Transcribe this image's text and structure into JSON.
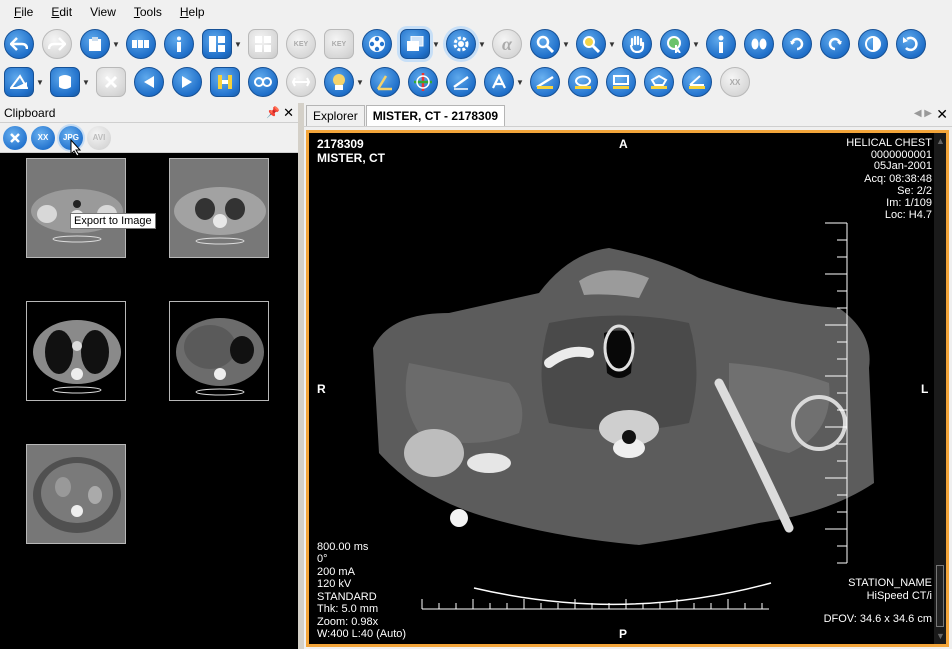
{
  "menu": {
    "file": {
      "accel": "F",
      "rest": "ile"
    },
    "edit": {
      "accel": "E",
      "rest": "dit"
    },
    "view": {
      "accel": "",
      "rest": "View"
    },
    "tools": {
      "accel": "T",
      "rest": "ools"
    },
    "help": {
      "accel": "H",
      "rest": "elp"
    }
  },
  "toolbar2": {
    "jpg_label": "JPG",
    "avi_label": "AVI"
  },
  "toolbar1": {
    "key_label_1": "KEY",
    "key_label_2": "KEY"
  },
  "clipboard": {
    "title": "Clipboard",
    "tool_xx": "XX",
    "tool_jpg": "JPG",
    "tool_avi": "AVI",
    "tooltip": "Export to Image",
    "thumb_count": 5
  },
  "tabs": [
    {
      "label": "Explorer"
    },
    {
      "label": "MISTER, CT - 2178309"
    }
  ],
  "viewer": {
    "top_left": {
      "id": "2178309",
      "name": "MISTER, CT"
    },
    "top_right": [
      "HELICAL CHEST",
      "0000000001",
      "05Jan-2001",
      "Acq: 08:38:48",
      "Se: 2/2",
      "Im: 1/109",
      "Loc: H4.7"
    ],
    "orient": {
      "top": "A",
      "bottom": "P",
      "left": "R",
      "right": "L"
    },
    "bottom_left": [
      "800.00 ms",
      "0°",
      "200 mA",
      "120 kV",
      "STANDARD",
      "Thk: 5.0 mm",
      "Zoom: 0.98x",
      "W:400 L:40 (Auto)"
    ],
    "bottom_right": [
      "STATION_NAME",
      "HiSpeed CT/i",
      "DFOV: 34.6 x 34.6 cm"
    ]
  }
}
